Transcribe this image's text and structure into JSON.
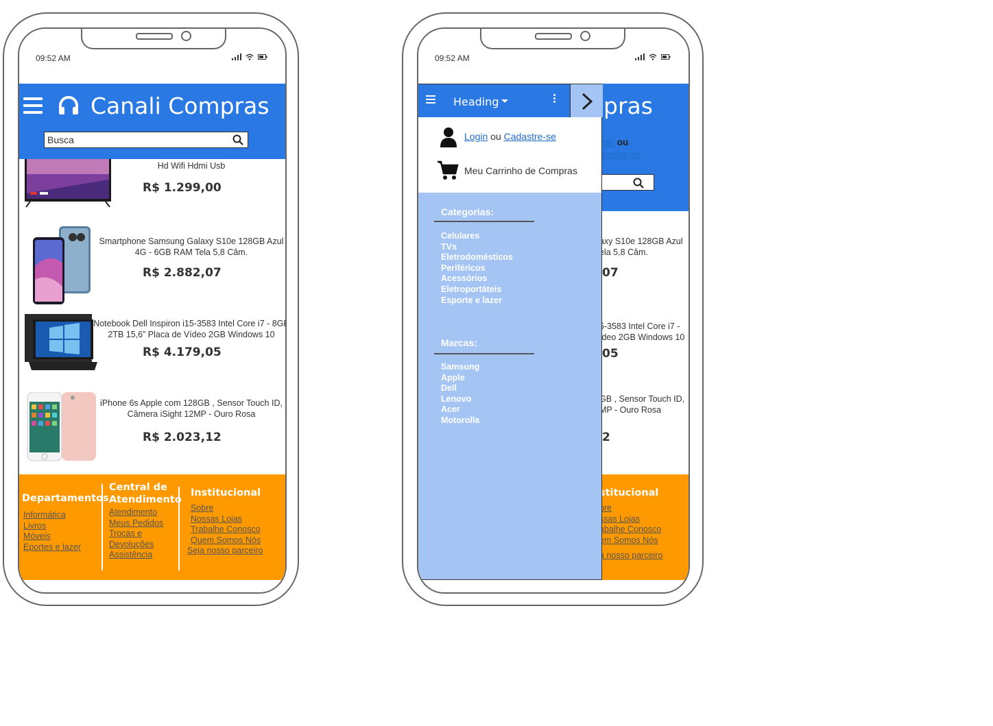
{
  "left_phone": {
    "time": "09:52 AM",
    "app_title": "Canali Compras",
    "search": {
      "value": "Busca"
    },
    "products": [
      {
        "name": "Hd Wifi Hdmi Usb",
        "price": "R$ 1.299,00",
        "image": "tv"
      },
      {
        "name": "Smartphone Samsung Galaxy S10e 128GB Azul 4G - 6GB RAM Tela 5,8 Câm.",
        "price": "R$ 2.882,07",
        "image": "phone"
      },
      {
        "name": "Notebook Dell Inspiron i15-3583 Intel Core i7 - 8GB 2TB 15,6” Placa de Vídeo 2GB Windows 10",
        "price": "R$ 4.179,05",
        "image": "laptop"
      },
      {
        "name": "iPhone 6s Apple com 128GB , Sensor Touch ID, Câmera iSight 12MP - Ouro Rosa",
        "price": "R$ 2.023,12",
        "image": "iphone"
      }
    ],
    "footer": {
      "departamentos": {
        "title": "Departamentos",
        "links": [
          "Informática",
          "Livros",
          "Móveis",
          "Eportes e lazer"
        ]
      },
      "central": {
        "title_line1": "Central de",
        "title_line2": "Atendimento",
        "links": [
          "Atendimento",
          "Meus Pedidos",
          "Trocas e",
          "Devoluções",
          "Assistência"
        ]
      },
      "institucional": {
        "title": "Institucional",
        "links": [
          "Sobre",
          "Nossas Lojas",
          "Trabalhe Conosco",
          "Quem Somos Nós",
          "Seja nosso parceiro"
        ]
      }
    }
  },
  "right_phone": {
    "time": "09:52 AM",
    "behind": {
      "title_fragment": "pras",
      "login_fragment": "gin",
      "ou": "ou",
      "cadastre_fragment": "dastre-se",
      "p1_name_1": "axy S10e 128GB Azul",
      "p1_name_2": "ela 5,8 Câm.",
      "p1_price": "07",
      "p2_name_1": "5-3583 Intel Core i7 -",
      "p2_name_2": "ídeo 2GB Windows 10",
      "p2_price": "05",
      "p3_name_1": "GB , Sensor Touch ID,",
      "p3_name_2": "MP - Ouro Rosa",
      "p3_price": "2",
      "footer_title": "stitucional",
      "footer_links": [
        "bre",
        "ssas Lojas",
        "abalhe Conosco",
        "em Somos Nós",
        "a nosso parceiro"
      ]
    },
    "drawer": {
      "heading": "Heading",
      "login": "Login",
      "ou": "ou",
      "cadastre": "Cadastre-se",
      "cart": "Meu Carrinho de Compras",
      "categorias_title": "Categorias:",
      "categorias": [
        "Celulares",
        "TVs",
        "Eletrodomésticos",
        "Periféricos",
        "Acessórios",
        "Eletroportáteis",
        "Esporte e lazer"
      ],
      "marcas_title": "Marcas:",
      "marcas": [
        "Samsung",
        "Apple",
        "Dell",
        "Lenovo",
        "Acer",
        "Motorolla"
      ]
    }
  },
  "colors": {
    "primary": "#2a78e4",
    "footer": "#ff9900",
    "drawer": "#a4c5f4"
  }
}
